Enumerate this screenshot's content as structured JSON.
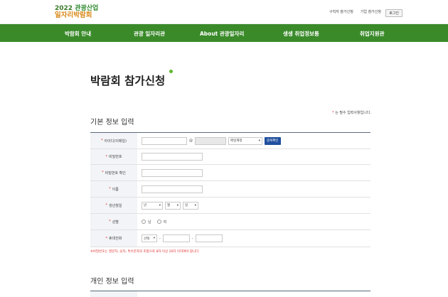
{
  "header": {
    "logo_year": "2022",
    "logo_line1": "관광산업",
    "logo_line2": "일자리박람회",
    "links": [
      "구직자 참가신청",
      "기업 참가신청"
    ],
    "login_label": "로그인"
  },
  "nav": {
    "items": [
      "박람회 안내",
      "관광 일자리관",
      "About 관광일자리",
      "생생 취업정보통",
      "취업지원관"
    ]
  },
  "page": {
    "title": "박람회 참가신청",
    "required_note_star": "*",
    "required_note": "는 필수 입력사항입니다."
  },
  "basic_section": {
    "title": "기본 정보 입력",
    "rows": {
      "id_label": "아이디(이메일)",
      "id_at": "@",
      "domain_select": "메일계정",
      "dup_button": "중복확인",
      "pw_label": "비밀번호",
      "pw_confirm_label": "비밀번호 확인",
      "name_label": "이름",
      "birth_label": "생년월일",
      "birth_year": "년",
      "birth_month": "월",
      "birth_day": "일",
      "gender_label": "성별",
      "gender_male": "남",
      "gender_female": "여",
      "phone_label": "휴대전화",
      "phone_select": "선택",
      "phone_dash": "-"
    },
    "warning": "※비밀번호는 영문자, 숫자, 특수문자의 조합으로 8자 이상 20자 이하여야 합니다."
  },
  "personal_section": {
    "title": "개인 정보 입력"
  },
  "colors": {
    "nav_green": "#3a8a2a",
    "accent_dot": "#5cb82e",
    "required_red": "#e03030",
    "dup_button_blue": "#1f4f9f"
  }
}
